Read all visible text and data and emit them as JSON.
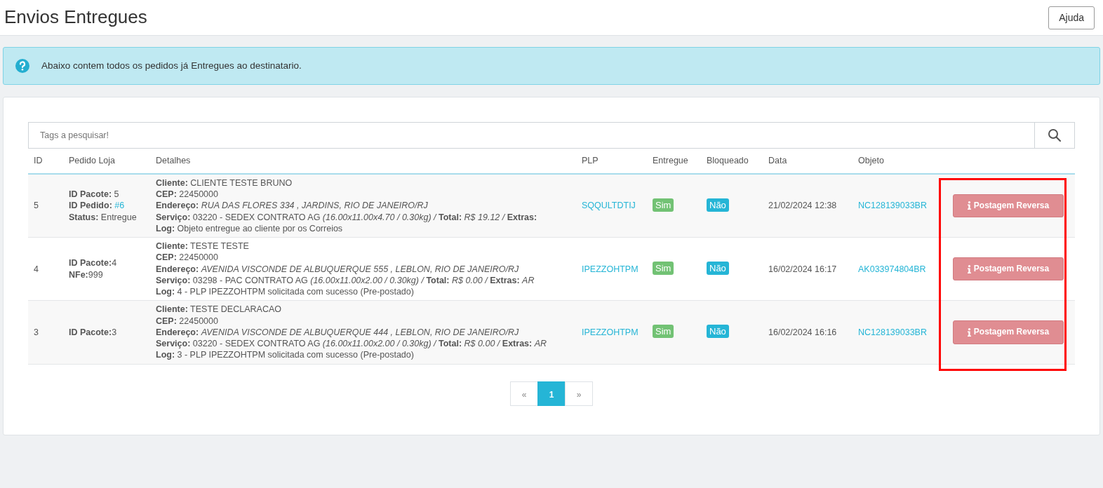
{
  "page": {
    "title": "Envios Entregues",
    "help_button": "Ajuda"
  },
  "alert": {
    "text": "Abaixo contem todos os pedidos já Entregues ao destinatario."
  },
  "search": {
    "placeholder": "Tags a pesquisar!"
  },
  "table": {
    "columns": [
      "ID",
      "Pedido Loja",
      "Detalhes",
      "PLP",
      "Entregue",
      "Bloqueado",
      "Data",
      "Objeto"
    ],
    "highlight_actions": true,
    "rows": [
      {
        "id": "5",
        "order": [
          {
            "label": "ID Pacote:",
            "value": " 5",
            "link": false
          },
          {
            "label": "ID Pedido:",
            "value": " #6",
            "link": true
          },
          {
            "label": "Status:",
            "value": " Entregue",
            "link": false
          }
        ],
        "details": [
          "**Cliente:** CLIENTE TESTE BRUNO",
          "**CEP:** 22450000",
          "**Endereço:** *RUA DAS FLORES 334 , JARDINS, RIO DE JANEIRO/RJ*",
          "**Serviço:** 03220 - SEDEX CONTRATO AG *(16.00x11.00x4.70 / 0.30kg) /* **Total:** *R$ 19.12 /* **Extras:**",
          "**Log:** Objeto entregue ao cliente por os Correios"
        ],
        "plp": "SQQULTDTIJ",
        "delivered": {
          "text": "Sim",
          "on": true
        },
        "blocked": {
          "text": "Não",
          "on": false
        },
        "date": "21/02/2024 12:38",
        "object": "NC128139033BR",
        "action": "Postagem Reversa"
      },
      {
        "id": "4",
        "order": [
          {
            "label": "ID Pacote:",
            "value": "4",
            "link": false
          },
          {
            "label": "NFe:",
            "value": "999",
            "link": false
          }
        ],
        "details": [
          "**Cliente:** TESTE TESTE",
          "**CEP:** 22450000",
          "**Endereço:** *AVENIDA VISCONDE DE ALBUQUERQUE 555 , LEBLON, RIO DE JANEIRO/RJ*",
          "**Serviço:** 03298 - PAC CONTRATO AG *(16.00x11.00x2.00 / 0.30kg) /* **Total:** *R$ 0.00 /* **Extras:** *AR*",
          "**Log:** 4 - PLP IPEZZOHTPM solicitada com sucesso (Pre-postado)"
        ],
        "plp": "IPEZZOHTPM",
        "delivered": {
          "text": "Sim",
          "on": true
        },
        "blocked": {
          "text": "Não",
          "on": false
        },
        "date": "16/02/2024 16:17",
        "object": "AK033974804BR",
        "action": "Postagem Reversa"
      },
      {
        "id": "3",
        "order": [
          {
            "label": "ID Pacote:",
            "value": "3",
            "link": false
          }
        ],
        "details": [
          "**Cliente:** TESTE DECLARACAO",
          "**CEP:** 22450000",
          "**Endereço:** *AVENIDA VISCONDE DE ALBUQUERQUE 444 , LEBLON, RIO DE JANEIRO/RJ*",
          "**Serviço:** 03220 - SEDEX CONTRATO AG *(16.00x11.00x2.00 / 0.30kg) /* **Total:** *R$ 0.00 /* **Extras:** *AR*",
          "**Log:** 3 - PLP IPEZZOHTPM solicitada com sucesso (Pre-postado)"
        ],
        "plp": "IPEZZOHTPM",
        "delivered": {
          "text": "Sim",
          "on": true
        },
        "blocked": {
          "text": "Não",
          "on": false
        },
        "date": "16/02/2024 16:16",
        "object": "NC128139033BR",
        "action": "Postagem Reversa"
      }
    ]
  },
  "pagination": [
    {
      "label": "«",
      "selected": false
    },
    {
      "label": "1",
      "selected": true
    },
    {
      "label": "»",
      "selected": false
    }
  ]
}
